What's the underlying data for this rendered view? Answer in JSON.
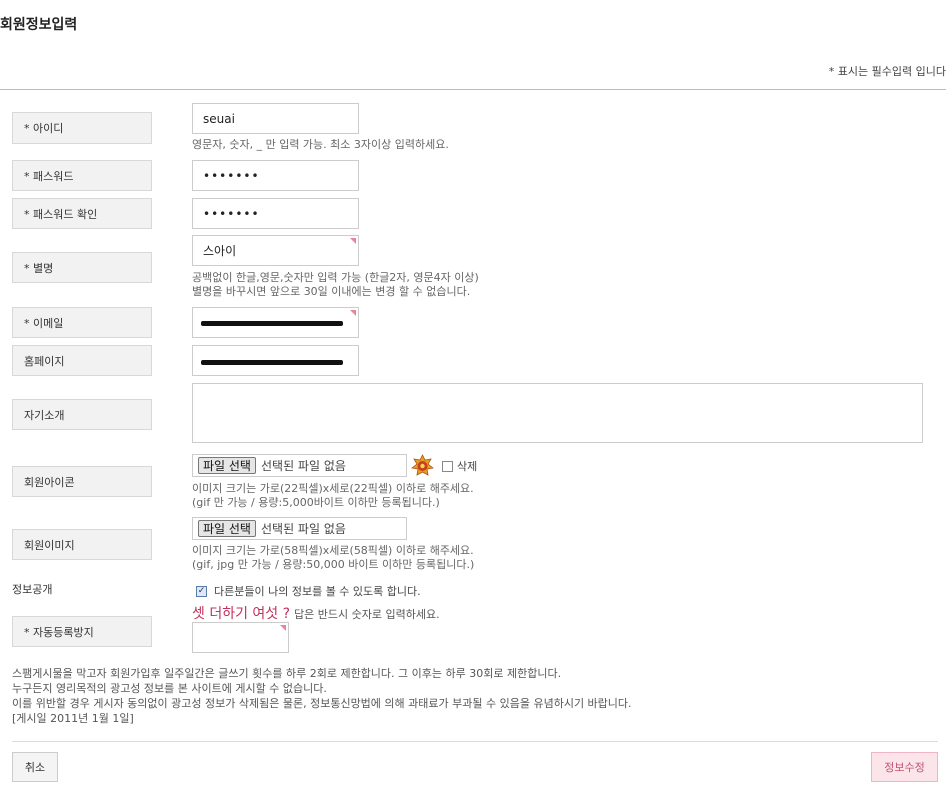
{
  "page": {
    "title": "회원정보입력",
    "required_note": "* 표시는 필수입력 입니다"
  },
  "fields": {
    "id": {
      "label": "* 아이디",
      "value": "seuai",
      "help": "영문자, 숫자, _ 만 입력 가능. 최소 3자이상 입력하세요."
    },
    "password": {
      "label": "* 패스워드",
      "value": "•••••••"
    },
    "password_confirm": {
      "label": "* 패스워드 확인",
      "value": "•••••••"
    },
    "nickname": {
      "label": "* 별명",
      "value": "스아이",
      "help1": "공백없이 한글,영문,숫자만 입력 가능 (한글2자, 영문4자 이상)",
      "help2": "별명을 바꾸시면 앞으로 30일 이내에는 변경 할 수 없습니다."
    },
    "email": {
      "label": "* 이메일"
    },
    "homepage": {
      "label": "홈페이지"
    },
    "intro": {
      "label": "자기소개"
    },
    "member_icon": {
      "label": "회원아이콘",
      "file_button": "파일 선택",
      "file_status": "선택된 파일 없음",
      "delete_label": "삭제",
      "help1": "이미지 크기는 가로(22픽셀)x세로(22픽셀) 이하로 해주세요.",
      "help2": "(gif 만 가능 / 용량:5,000바이트 이하만 등록됩니다.)"
    },
    "member_image": {
      "label": "회원이미지",
      "file_button": "파일 선택",
      "file_status": "선택된 파일 없음",
      "help1": "이미지 크기는 가로(58픽셀)x세로(58픽셀) 이하로 해주세요.",
      "help2": "(gif, jpg 만 가능 / 용량:50,000 바이트 이하만 등록됩니다.)"
    },
    "public_info": {
      "label": "정보공개",
      "checkbox_label": "다른분들이 나의 정보를 볼 수 있도록 합니다."
    },
    "captcha": {
      "label": "* 자동등록방지",
      "question": "셋 더하기 여섯 ?",
      "help": "답은 반드시 숫자로 입력하세요."
    }
  },
  "notice": {
    "line1": "스팸게시물을 막고자 회원가입후 일주일간은 글쓰기 횟수를 하루 2회로 제한합니다. 그 이후는 하루 30회로 제한합니다.",
    "line2": "누구든지 영리목적의 광고성 정보를 본 사이트에 게시할 수 없습니다.",
    "line3": "이를 위반할 경우 게시자 동의없이 광고성 정보가 삭제됨은 물론, 정보통신망법에 의해 과태료가 부과될 수 있음을 유념하시기 바랍니다.",
    "line4": "[게시일 2011년 1월 1일]"
  },
  "buttons": {
    "cancel": "취소",
    "submit": "정보수정"
  },
  "colors": {
    "accent": "#c2305d",
    "submit_bg": "#fbe4ea"
  }
}
